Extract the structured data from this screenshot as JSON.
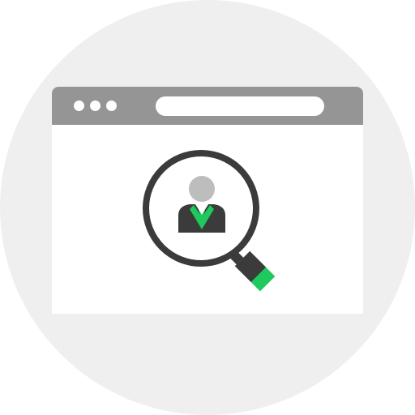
{
  "illustration": {
    "subject": "search-user-in-browser",
    "icons": [
      "browser-window-icon",
      "magnifying-glass-icon",
      "user-avatar-icon"
    ],
    "colors": {
      "background_circle": "#efefef",
      "title_bar": "#959595",
      "window_body": "#ffffff",
      "lens_ring": "#3b3b3b",
      "handle_dark": "#3b3b3b",
      "accent_green": "#1ec95e",
      "avatar_head": "#bdbdbd",
      "avatar_suit": "#3b3b3b"
    }
  }
}
